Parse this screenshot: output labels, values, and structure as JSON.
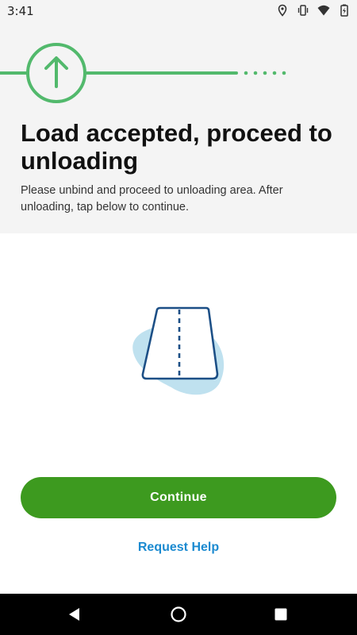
{
  "status_bar": {
    "time": "3:41",
    "icons": [
      "location-icon",
      "vibrate-icon",
      "wifi-icon",
      "battery-charging-icon"
    ]
  },
  "progress": {
    "current_step_icon": "arrow-up-icon",
    "accent_color": "#52b96c"
  },
  "header": {
    "title": "Load accepted, proceed to unloading",
    "subtitle": "Please unbind and proceed to unloading area. After unloading, tap below to continue."
  },
  "illustration": {
    "icon": "road-icon"
  },
  "actions": {
    "continue_label": "Continue",
    "help_label": "Request Help",
    "continue_color": "#3d9a1f",
    "help_color": "#1b8ad0"
  },
  "nav_bar": {
    "buttons": [
      "back-icon",
      "home-icon",
      "recents-icon"
    ]
  }
}
